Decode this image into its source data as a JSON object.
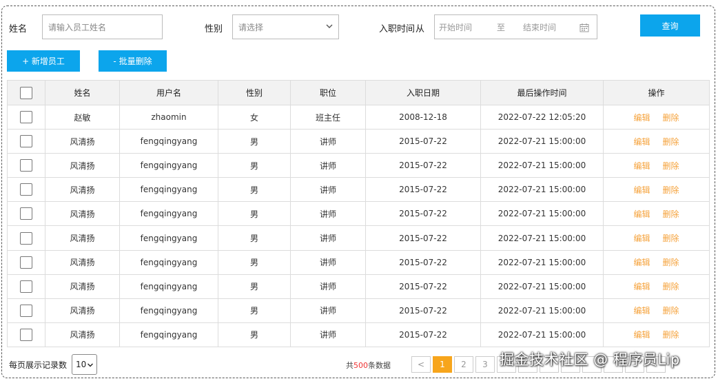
{
  "search": {
    "name_label": "姓名",
    "name_placeholder": "请输入员工姓名",
    "gender_label": "性别",
    "gender_placeholder": "请选择",
    "date_label": "入职时间",
    "date_from": "从",
    "date_start_placeholder": "开始时间",
    "date_sep": "至",
    "date_end_placeholder": "结束时间",
    "query_button": "查询"
  },
  "toolbar": {
    "add_button": "+ 新增员工",
    "batch_delete_button": "- 批量删除"
  },
  "table": {
    "columns": [
      "姓名",
      "用户名",
      "性别",
      "职位",
      "入职日期",
      "最后操作时间",
      "操作"
    ],
    "rows": [
      {
        "name": "赵敏",
        "username": "zhaomin",
        "gender": "女",
        "position": "班主任",
        "entry_date": "2008-12-18",
        "last_op": "2022-07-22 12:05:20"
      },
      {
        "name": "风清扬",
        "username": "fengqingyang",
        "gender": "男",
        "position": "讲师",
        "entry_date": "2015-07-22",
        "last_op": "2022-07-21 15:00:00"
      },
      {
        "name": "风清扬",
        "username": "fengqingyang",
        "gender": "男",
        "position": "讲师",
        "entry_date": "2015-07-22",
        "last_op": "2022-07-21 15:00:00"
      },
      {
        "name": "风清扬",
        "username": "fengqingyang",
        "gender": "男",
        "position": "讲师",
        "entry_date": "2015-07-22",
        "last_op": "2022-07-21 15:00:00"
      },
      {
        "name": "风清扬",
        "username": "fengqingyang",
        "gender": "男",
        "position": "讲师",
        "entry_date": "2015-07-22",
        "last_op": "2022-07-21 15:00:00"
      },
      {
        "name": "风清扬",
        "username": "fengqingyang",
        "gender": "男",
        "position": "讲师",
        "entry_date": "2015-07-22",
        "last_op": "2022-07-21 15:00:00"
      },
      {
        "name": "风清扬",
        "username": "fengqingyang",
        "gender": "男",
        "position": "讲师",
        "entry_date": "2015-07-22",
        "last_op": "2022-07-21 15:00:00"
      },
      {
        "name": "风清扬",
        "username": "fengqingyang",
        "gender": "男",
        "position": "讲师",
        "entry_date": "2015-07-22",
        "last_op": "2022-07-21 15:00:00"
      },
      {
        "name": "风清扬",
        "username": "fengqingyang",
        "gender": "男",
        "position": "讲师",
        "entry_date": "2015-07-22",
        "last_op": "2022-07-21 15:00:00"
      },
      {
        "name": "风清扬",
        "username": "fengqingyang",
        "gender": "男",
        "position": "讲师",
        "entry_date": "2015-07-22",
        "last_op": "2022-07-21 15:00:00"
      }
    ],
    "edit_label": "编辑",
    "delete_label": "删除"
  },
  "footer": {
    "page_size_label": "每页展示记录数",
    "page_size_value": "10",
    "total_prefix": "共",
    "total_count": "500",
    "total_suffix": "条数据",
    "prev_symbol": "<",
    "pages": [
      "1",
      "2",
      "3"
    ],
    "current_page": "1"
  },
  "watermark": "掘金技术社区 @ 程序员Lip",
  "colors": {
    "primary_button": "#0ca5ec",
    "action_link": "#f5a23b",
    "active_page": "#f7a51c",
    "total_count": "#ee3333"
  },
  "icons": {
    "gender_select": "chevron-down-icon",
    "date_picker": "calendar-icon",
    "page_size_select": "chevron-down-icon"
  }
}
